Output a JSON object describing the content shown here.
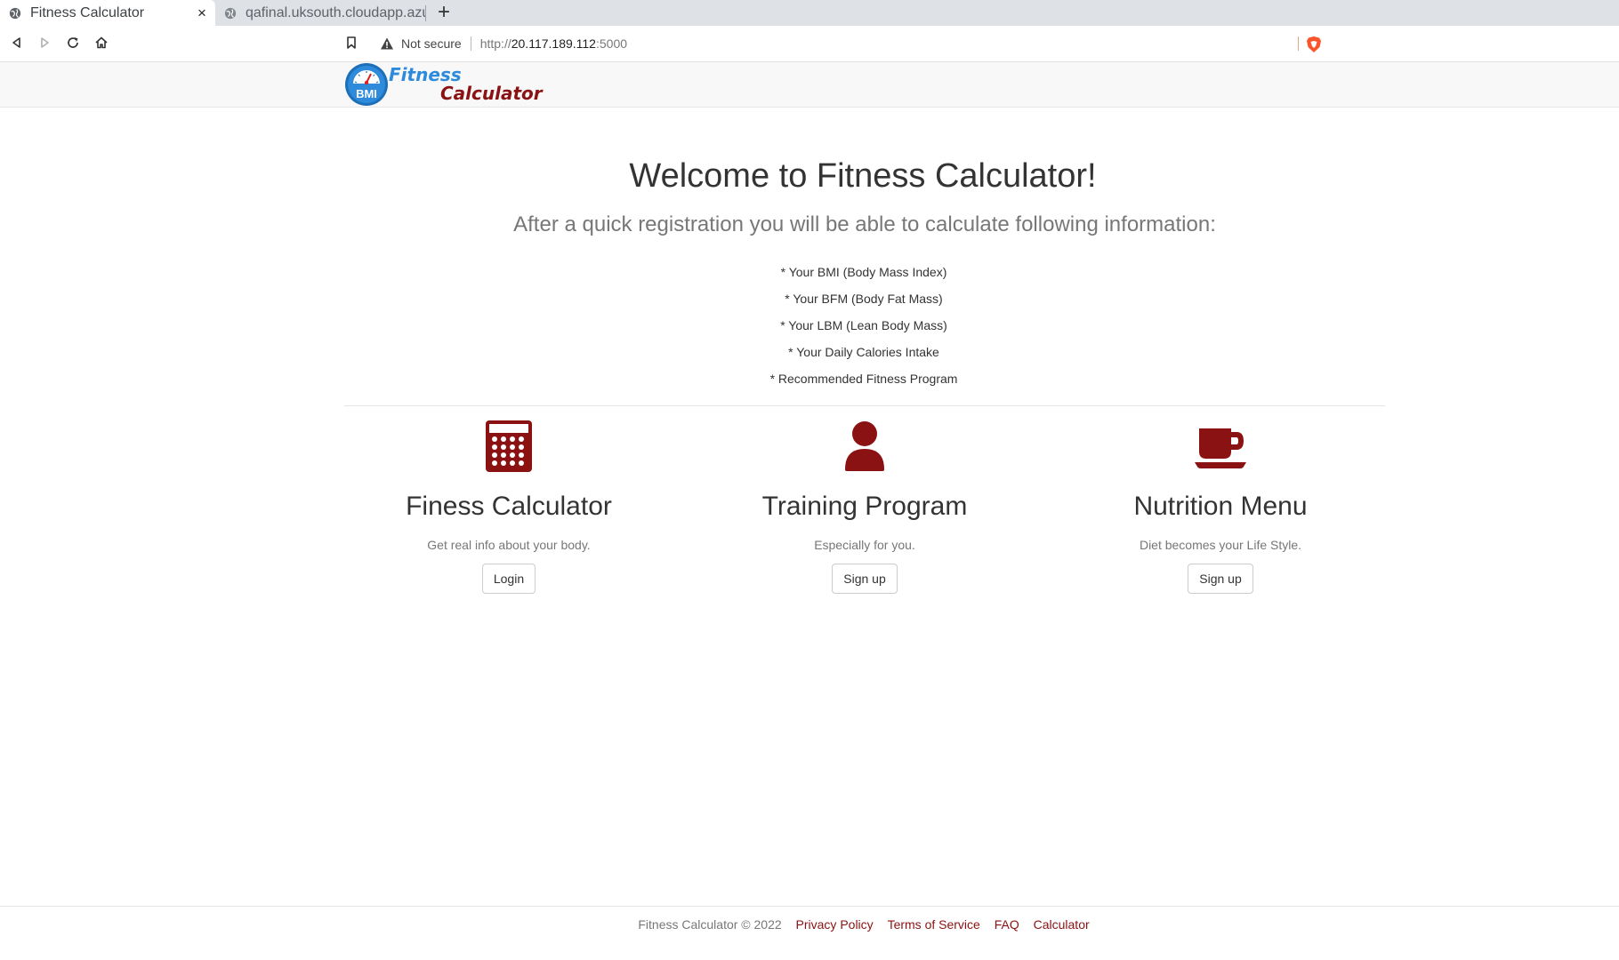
{
  "browser": {
    "tabs": [
      {
        "title": "Fitness Calculator",
        "active": true
      },
      {
        "title": "qafinal.uksouth.cloudapp.azur",
        "active": false
      }
    ],
    "new_tab": "+",
    "close_tab": "×",
    "address": {
      "security_label": "Not secure",
      "protocol": "http://",
      "host": "20.117.189.112",
      "port": ":5000"
    }
  },
  "site": {
    "brand": {
      "line1": "Fitness",
      "line2": "Calculator",
      "logo_text": "BMI"
    },
    "hero": {
      "title": "Welcome to Fitness Calculator!",
      "subtitle": "After a quick registration you will be able to calculate following information:",
      "features": [
        "* Your BMI (Body Mass Index)",
        "* Your BFM (Body Fat Mass)",
        "* Your LBM (Lean Body Mass)",
        "* Your Daily Calories Intake",
        "* Recommended Fitness Program"
      ]
    },
    "columns": [
      {
        "icon": "calculator-icon",
        "title": "Finess Calculator",
        "text": "Get real info about your body.",
        "button": "Login"
      },
      {
        "icon": "user-icon",
        "title": "Training Program",
        "text": "Especially for you.",
        "button": "Sign up"
      },
      {
        "icon": "coffee-cup-icon",
        "title": "Nutrition Menu",
        "text": "Diet becomes your Life Style.",
        "button": "Sign up"
      }
    ],
    "footer": {
      "copyright": "Fitness Calculator © 2022",
      "links": [
        "Privacy Policy",
        "Terms of Service",
        "FAQ",
        "Calculator"
      ]
    }
  },
  "colors": {
    "accent_dark_red": "#8b1212",
    "brand_blue": "#2e8bdc",
    "muted_text": "#777777"
  }
}
